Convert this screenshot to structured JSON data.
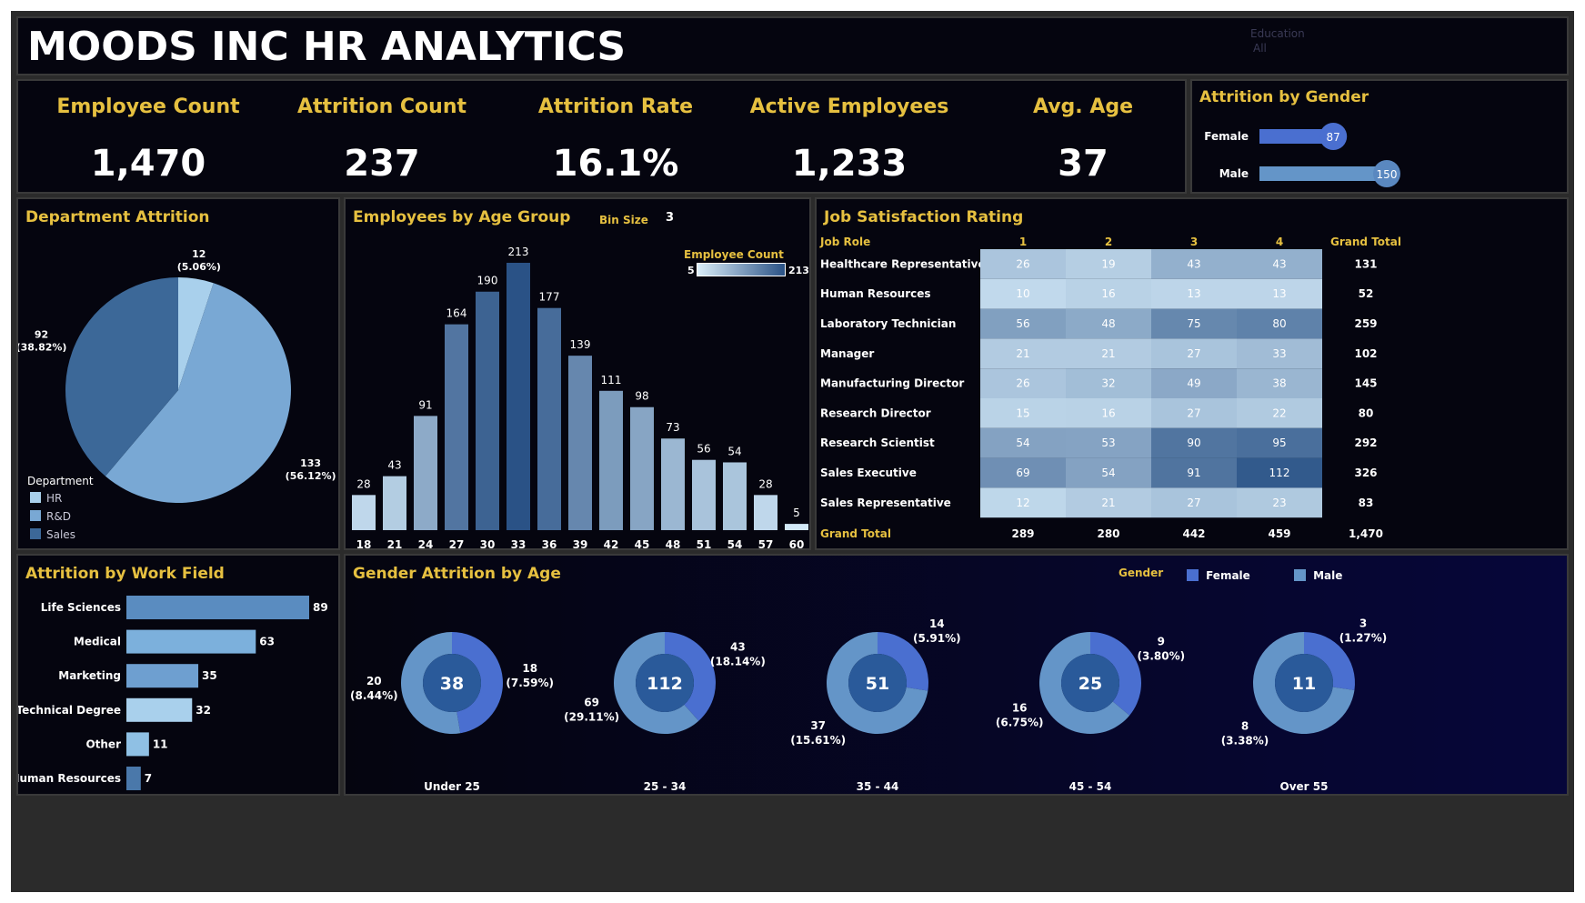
{
  "header": {
    "title": "MOODS INC HR ANALYTICS",
    "filter_label": "Education",
    "filter_value": "All"
  },
  "kpis": [
    {
      "label": "Employee Count",
      "value": "1,470"
    },
    {
      "label": "Attrition Count",
      "value": "237"
    },
    {
      "label": "Attrition Rate",
      "value": "16.1%"
    },
    {
      "label": "Active Employees",
      "value": "1,233"
    },
    {
      "label": "Avg. Age",
      "value": "37"
    }
  ],
  "gender_panel": {
    "title": "Attrition by Gender"
  },
  "department_panel": {
    "title": "Department Attrition",
    "legend_title": "Department"
  },
  "age_panel": {
    "title": "Employees by Age Group",
    "bin_label": "Bin Size",
    "bin_value": "3",
    "legend_title": "Employee Count",
    "legend_min": "5",
    "legend_max": "213"
  },
  "job_panel": {
    "title": "Job Satisfaction Rating"
  },
  "field_panel": {
    "title": "Attrition by Work Field"
  },
  "gender_age_panel": {
    "title": "Gender Attrition by Age",
    "legend_title": "Gender",
    "legend_items": [
      "Female",
      "Male"
    ]
  },
  "colors": {
    "female": "#4a6fd0",
    "male": "#6495c8",
    "accent": "#e6c040",
    "background": "#05050f"
  },
  "chart_data": [
    {
      "id": "gender",
      "type": "bar",
      "title": "Attrition by Gender",
      "categories": [
        "Female",
        "Male"
      ],
      "values": [
        87,
        150
      ],
      "xlim": [
        0,
        150
      ]
    },
    {
      "id": "department",
      "type": "pie",
      "title": "Department Attrition",
      "legend_title": "Department",
      "categories": [
        "HR",
        "R&D",
        "Sales"
      ],
      "values": [
        12,
        133,
        92
      ],
      "labels": [
        "(5.06%)",
        "(56.12%)",
        "(38.82%)"
      ],
      "colors": [
        "#a9d0ec",
        "#79a8d4",
        "#3c6898"
      ],
      "legend_position": "bottom-left"
    },
    {
      "id": "age",
      "type": "bar",
      "title": "Employees by Age Group",
      "categories": [
        "18",
        "21",
        "24",
        "27",
        "30",
        "33",
        "36",
        "39",
        "42",
        "45",
        "48",
        "51",
        "54",
        "57",
        "60"
      ],
      "values": [
        28,
        43,
        91,
        164,
        190,
        213,
        177,
        139,
        111,
        98,
        73,
        56,
        54,
        28,
        5
      ],
      "color_scale": {
        "title": "Employee Count",
        "min": 5,
        "max": 213
      },
      "ylim": [
        0,
        213
      ]
    },
    {
      "id": "job",
      "type": "heatmap",
      "title": "Job Satisfaction Rating",
      "row_header": "Job Role",
      "columns": [
        "1",
        "2",
        "3",
        "4"
      ],
      "total_label": "Grand Total",
      "rows": [
        "Healthcare Representative",
        "Human Resources",
        "Laboratory Technician",
        "Manager",
        "Manufacturing Director",
        "Research Director",
        "Research Scientist",
        "Sales Executive",
        "Sales Representative"
      ],
      "values": [
        [
          26,
          19,
          43,
          43
        ],
        [
          10,
          16,
          13,
          13
        ],
        [
          56,
          48,
          75,
          80
        ],
        [
          21,
          21,
          27,
          33
        ],
        [
          26,
          32,
          49,
          38
        ],
        [
          15,
          16,
          27,
          22
        ],
        [
          54,
          53,
          90,
          95
        ],
        [
          69,
          54,
          91,
          112
        ],
        [
          12,
          21,
          27,
          23
        ]
      ],
      "row_totals": [
        "131",
        "52",
        "259",
        "102",
        "145",
        "80",
        "292",
        "326",
        "83"
      ],
      "column_totals": [
        "289",
        "280",
        "442",
        "459"
      ],
      "grand_total": "1,470"
    },
    {
      "id": "field",
      "type": "bar",
      "title": "Attrition by Work Field",
      "orientation": "horizontal",
      "categories": [
        "Life Sciences",
        "Medical",
        "Marketing",
        "Technical Degree",
        "Other",
        "Human Resources"
      ],
      "values": [
        89,
        63,
        35,
        32,
        11,
        7
      ],
      "colors": [
        "#5a8cc0",
        "#7cb0dc",
        "#6e9fd0",
        "#a9d0ec",
        "#8fc0e4",
        "#4a78aa"
      ],
      "xlim": [
        0,
        89
      ]
    },
    {
      "id": "gender_age",
      "type": "pie",
      "title": "Gender Attrition by Age",
      "legend": [
        "Female",
        "Male"
      ],
      "groups": [
        {
          "label": "Under 25",
          "total": 38,
          "female": 18,
          "female_pct": "(7.59%)",
          "male": 20,
          "male_pct": "(8.44%)"
        },
        {
          "label": "25 - 34",
          "total": 112,
          "female": 43,
          "female_pct": "(18.14%)",
          "male": 69,
          "male_pct": "(29.11%)"
        },
        {
          "label": "35 - 44",
          "total": 51,
          "female": 14,
          "female_pct": "(5.91%)",
          "male": 37,
          "male_pct": "(15.61%)"
        },
        {
          "label": "45 - 54",
          "total": 25,
          "female": 9,
          "female_pct": "(3.80%)",
          "male": 16,
          "male_pct": "(6.75%)"
        },
        {
          "label": "Over 55",
          "total": 11,
          "female": 3,
          "female_pct": "(1.27%)",
          "male": 8,
          "male_pct": "(3.38%)"
        }
      ]
    }
  ]
}
